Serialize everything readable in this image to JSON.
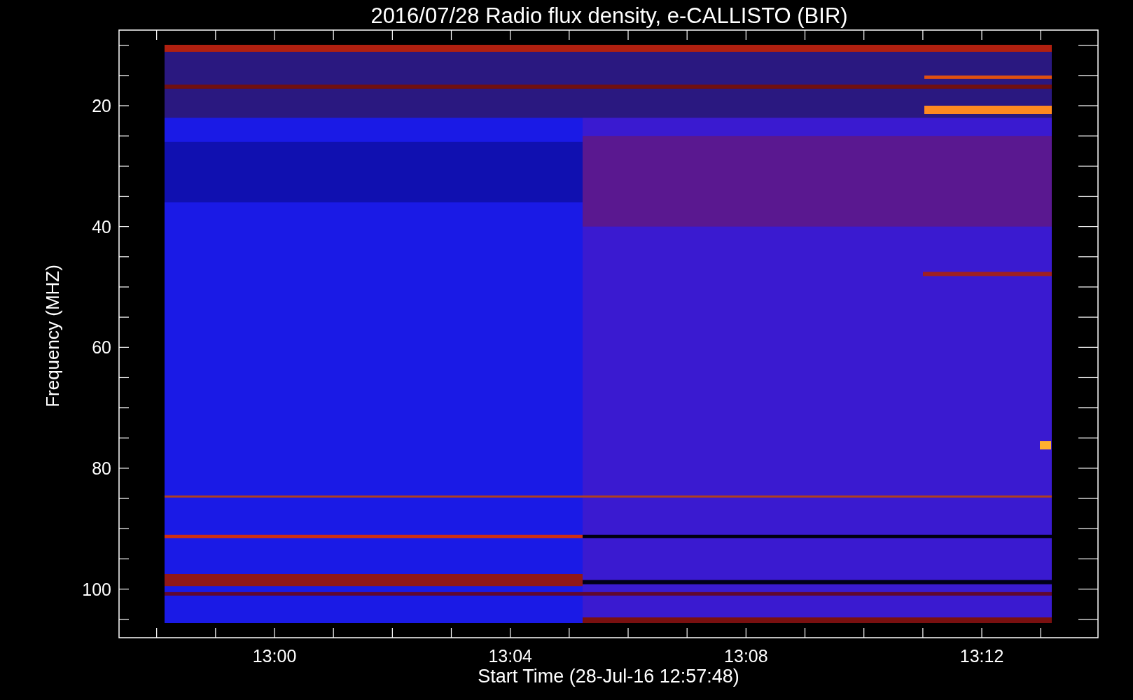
{
  "title": "2016/07/28  Radio flux density, e-CALLISTO (BIR)",
  "y_axis": {
    "label": "Frequency (MHZ)",
    "ticks": [
      "20",
      "40",
      "60",
      "80",
      "100"
    ]
  },
  "x_axis": {
    "label": "Start Time (28-Jul-16 12:57:48)",
    "ticks": [
      "13:00",
      "13:04",
      "13:08",
      "13:12"
    ]
  }
}
